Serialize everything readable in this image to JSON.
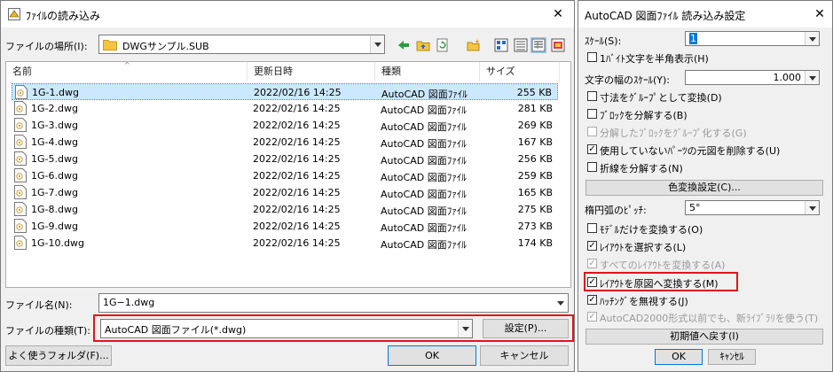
{
  "open_dialog": {
    "title": "ﾌｧｲﾙの読み込み",
    "close_glyph": "✕",
    "location_label": "ファイルの場所(I):",
    "location_value": "DWGサンプル.SUB",
    "columns": [
      {
        "label": "名前"
      },
      {
        "label": "更新日時"
      },
      {
        "label": "種類"
      },
      {
        "label": "サイズ"
      }
    ],
    "files": [
      {
        "name": "1G-1.dwg",
        "date": "2022/02/16 14:25",
        "type": "AutoCAD 図面ﾌｧｲﾙ",
        "size": "255 KB"
      },
      {
        "name": "1G-2.dwg",
        "date": "2022/02/16 14:25",
        "type": "AutoCAD 図面ﾌｧｲﾙ",
        "size": "281 KB"
      },
      {
        "name": "1G-3.dwg",
        "date": "2022/02/16 14:25",
        "type": "AutoCAD 図面ﾌｧｲﾙ",
        "size": "269 KB"
      },
      {
        "name": "1G-4.dwg",
        "date": "2022/02/16 14:25",
        "type": "AutoCAD 図面ﾌｧｲﾙ",
        "size": "167 KB"
      },
      {
        "name": "1G-5.dwg",
        "date": "2022/02/16 14:25",
        "type": "AutoCAD 図面ﾌｧｲﾙ",
        "size": "256 KB"
      },
      {
        "name": "1G-6.dwg",
        "date": "2022/02/16 14:25",
        "type": "AutoCAD 図面ﾌｧｲﾙ",
        "size": "259 KB"
      },
      {
        "name": "1G-7.dwg",
        "date": "2022/02/16 14:25",
        "type": "AutoCAD 図面ﾌｧｲﾙ",
        "size": "165 KB"
      },
      {
        "name": "1G-8.dwg",
        "date": "2022/02/16 14:25",
        "type": "AutoCAD 図面ﾌｧｲﾙ",
        "size": "275 KB"
      },
      {
        "name": "1G-9.dwg",
        "date": "2022/02/16 14:25",
        "type": "AutoCAD 図面ﾌｧｲﾙ",
        "size": "273 KB"
      },
      {
        "name": "1G-10.dwg",
        "date": "2022/02/16 14:25",
        "type": "AutoCAD 図面ﾌｧｲﾙ",
        "size": "174 KB"
      }
    ],
    "filename_label": "ファイル名(N):",
    "filename_value": "1G−1.dwg",
    "filetype_label": "ファイルの種類(T):",
    "filetype_value": "AutoCAD 図面ファイル(*.dwg)",
    "settings_button": "設定(P)...",
    "favorites_button": "よく使うフォルダ(F)...",
    "ok_button": "OK",
    "cancel_button": "キャンセル"
  },
  "settings_dialog": {
    "title": "AutoCAD 図面ﾌｧｲﾙ 読み込み設定",
    "close_glyph": "✕",
    "scale_label": "ｽｹｰﾙ(S):",
    "scale_value": "1",
    "halfwidth_label": "1ﾊﾞｲﾄ文字を半角表示(H)",
    "charwidth_label": "文字の幅のｽｹｰﾙ(Y):",
    "charwidth_value": "1.000",
    "dim_group_label": "寸法をｸﾞﾙｰﾌﾟとして変換(D)",
    "explode_block_label": "ﾌﾞﾛｯｸを分解する(B)",
    "group_exploded_label": "分解したﾌﾞﾛｯｸをｸﾞﾙｰﾌﾟ化する(G)",
    "delete_parts_label": "使用していないﾊﾟｰﾂの元図を削除する(U)",
    "explode_polyline_label": "折線を分解する(N)",
    "color_button": "色変換設定(C)...",
    "arc_pitch_label": "楕円弧のﾋﾟｯﾁ:",
    "arc_pitch_value": "5°",
    "model_only_label": "ﾓﾃﾞﾙだけを変換する(O)",
    "select_layout_label": "ﾚｲｱｳﾄを選択する(L)",
    "all_layouts_label": "すべてのﾚｲｱｳﾄを変換する(A)",
    "layout_to_original_label": "ﾚｲｱｳﾄを原図へ変換する(M)",
    "ignore_hatch_label": "ﾊｯﾁﾝｸﾞを無視する(J)",
    "new_library_label": "AutoCAD2000形式以前でも、新ﾗｲﾌﾞﾗﾘを使う(T)",
    "reset_button": "初期値へ戻す(I)",
    "ok_button": "OK",
    "cancel_button": "ｷｬﾝｾﾙ",
    "checks": {
      "halfwidth": "",
      "dim_group": "",
      "explode_block": "",
      "group_exploded": "",
      "delete_parts": "✓",
      "explode_polyline": "",
      "model_only": "",
      "select_layout": "✓",
      "all_layouts": "✓",
      "layout_to_original": "✓",
      "ignore_hatch": "✓",
      "new_library": "✓"
    }
  },
  "colors": {
    "highlight_box": "#e0141e",
    "selection": "#cce8ff",
    "folder_yellow": "#f5c542"
  }
}
